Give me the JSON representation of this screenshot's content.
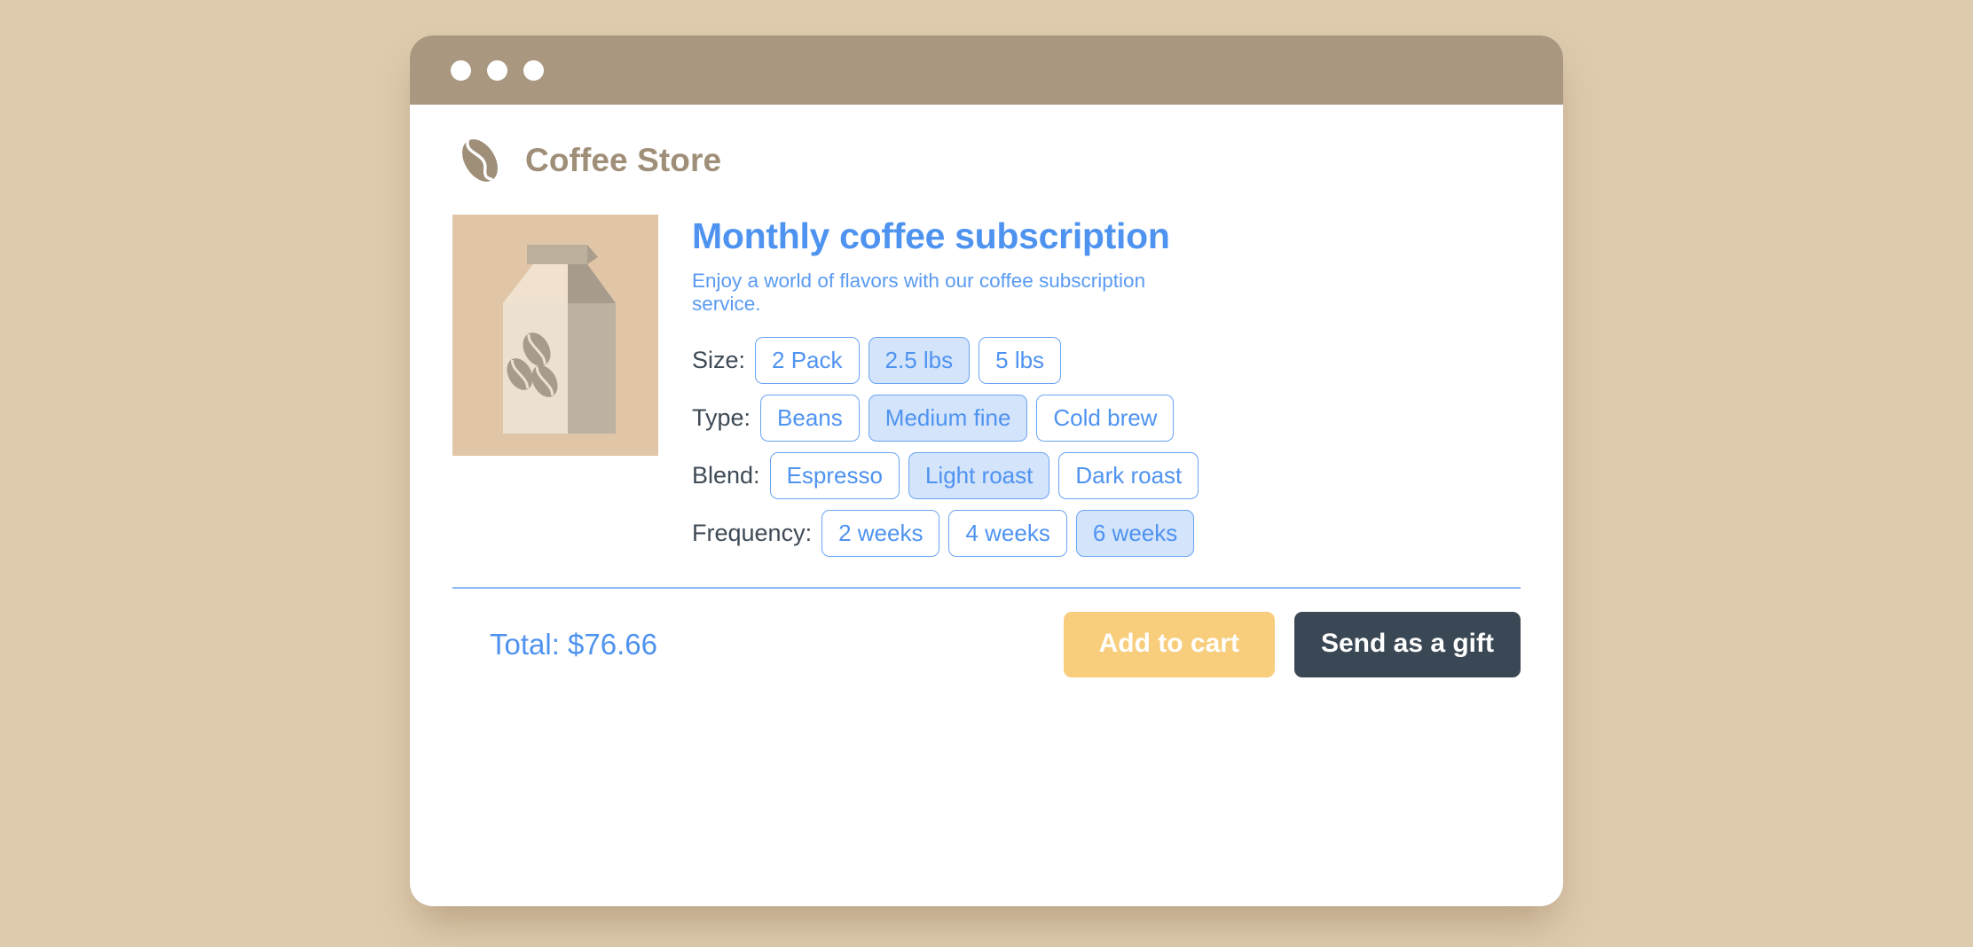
{
  "theme": {
    "page_background": "#decbae",
    "titlebar": "#a9977f",
    "brand_color": "#a08f78",
    "accent_blue": "#4f93f0",
    "selected_fill": "#d3e4fb",
    "cart_button": "#f8cd7c",
    "gift_button": "#3a4754",
    "label_color": "#3e4a55",
    "product_image_background": "#e0c6a6"
  },
  "window": {
    "traffic_lights": [
      "close-dot",
      "minimize-dot",
      "maximize-dot"
    ]
  },
  "brand": {
    "logo_icon": "coffee-bean-icon",
    "name": "Coffee Store"
  },
  "product": {
    "image_icon": "coffee-carton-illustration",
    "title": "Monthly coffee subscription",
    "description": "Enjoy a world of flavors with our coffee subscription service."
  },
  "options": [
    {
      "key": "size",
      "label": "Size:",
      "choices": [
        {
          "label": "2 Pack",
          "selected": false
        },
        {
          "label": "2.5 lbs",
          "selected": true
        },
        {
          "label": "5 lbs",
          "selected": false
        }
      ]
    },
    {
      "key": "type",
      "label": "Type:",
      "choices": [
        {
          "label": "Beans",
          "selected": false
        },
        {
          "label": "Medium fine",
          "selected": true
        },
        {
          "label": "Cold brew",
          "selected": false
        }
      ]
    },
    {
      "key": "blend",
      "label": "Blend:",
      "choices": [
        {
          "label": "Espresso",
          "selected": false
        },
        {
          "label": "Light roast",
          "selected": true
        },
        {
          "label": "Dark roast",
          "selected": false
        }
      ]
    },
    {
      "key": "frequency",
      "label": "Frequency:",
      "choices": [
        {
          "label": "2 weeks",
          "selected": false
        },
        {
          "label": "4 weeks",
          "selected": false
        },
        {
          "label": "6 weeks",
          "selected": true
        }
      ]
    }
  ],
  "footer": {
    "total_label": "Total: $76.66",
    "add_to_cart_label": "Add to cart",
    "send_as_gift_label": "Send as a gift"
  }
}
